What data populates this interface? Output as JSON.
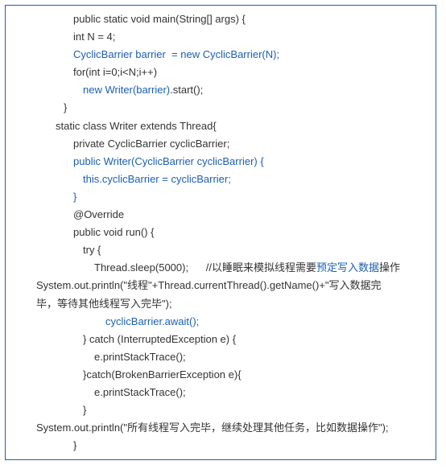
{
  "code": {
    "l1a": "public static void main(String[] args) {",
    "l2a": "int N = 4;",
    "l3a": "CyclicBarrier barrier  = new CyclicBarrier(N);",
    "l4a": "for(int i=0;i<N;i++)",
    "l5a": "new Writer(barrier)",
    "l5b": ".start();",
    "l6a": "}",
    "l7a": "static class Writer extends Thread{",
    "l8a": "private CyclicBarrier cyclicBarrier;",
    "l9a": "public Writer(CyclicBarrier cyclicBarrier) {",
    "l10a": "this.cyclicBarrier = cyclicBarrier;",
    "l11a": "}",
    "l12a": "@Override",
    "l13a": "public void run() {",
    "l14a": "try {",
    "l15a": "Thread.sleep(5000);      //以睡眠来模拟线程需要",
    "l15b": "预定写入数据",
    "l15c": "操作",
    "l16a": "System.out.println(\"线程\"+Thread.currentThread().getName()+\"写入数据完",
    "l17a": "毕，等待其他线程写入完毕\");",
    "l18a": "cyclicBarrier.await();",
    "l19a": "} catch (InterruptedException e) {",
    "l20a": "e.printStackTrace();",
    "l21a": "}catch(BrokenBarrierException e){",
    "l22a": "e.printStackTrace();",
    "l23a": "}",
    "l24a": "System.out.println(\"所有线程写入完毕，继续处理其他任务，比如数据操作\");",
    "l25a": "}"
  }
}
